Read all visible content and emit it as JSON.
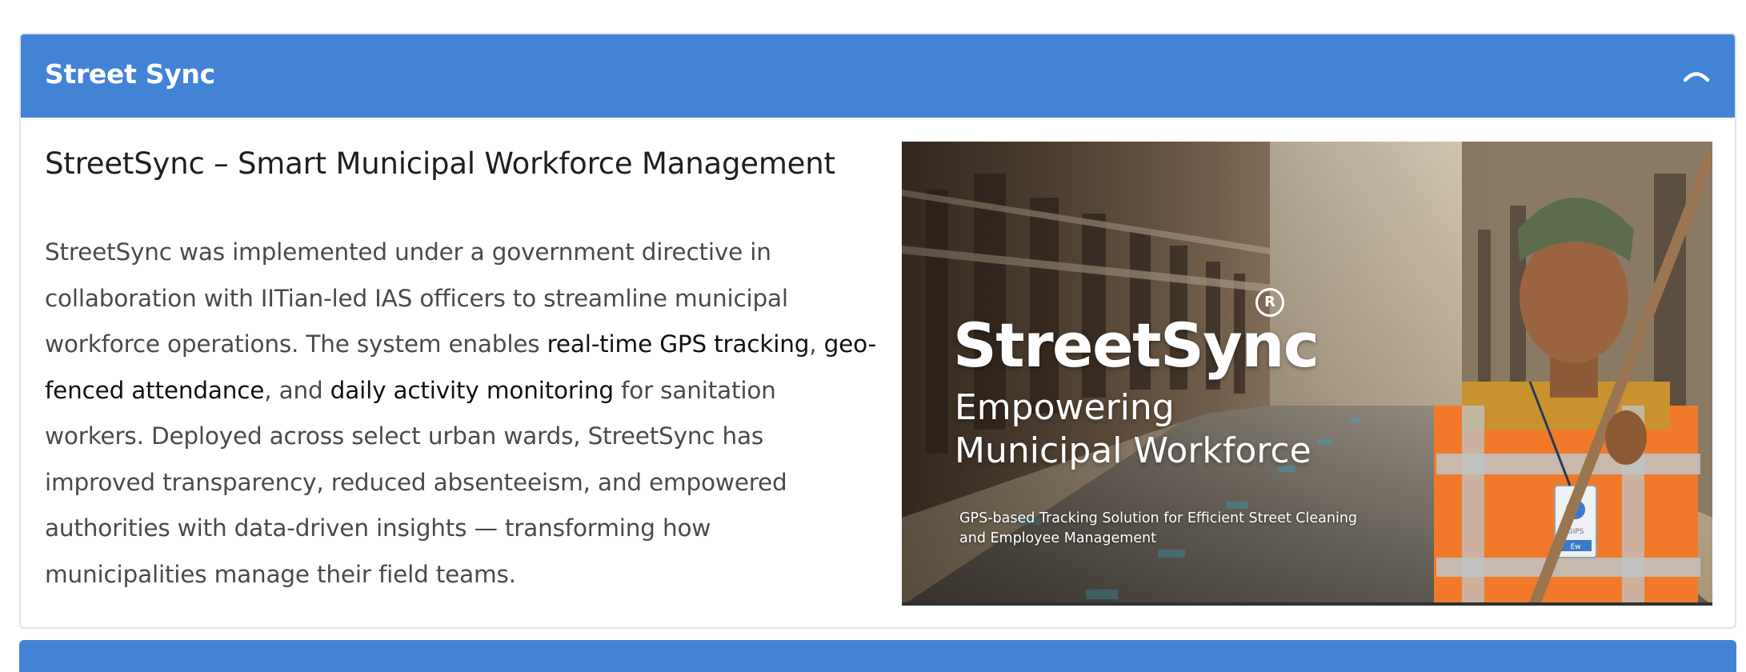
{
  "section": {
    "title": "Street Sync",
    "toggle_icon": "chevron-up-icon"
  },
  "content": {
    "heading": "StreetSync – Smart Municipal Workforce Management",
    "paragraph": {
      "p1": "StreetSync was implemented under a government directive in collaboration with IITian-led IAS officers to streamline municipal workforce operations. The system enables ",
      "h1": "real-time GPS tracking",
      "p2": ", ",
      "h2": "geo-fenced attendance",
      "p3": ", and ",
      "h3": "daily activity monitoring",
      "p4": " for sanitation workers. Deployed across select urban wards, StreetSync has improved transparency, reduced absenteeism, and empowered authorities with data-driven insights — transforming how municipalities manage their field teams."
    }
  },
  "banner": {
    "brand": "StreetSync",
    "registered_mark": "R",
    "tagline_line1": "Empowering",
    "tagline_line2": "Municipal Workforce",
    "subtext_line1": "GPS-based Tracking Solution for Efficient Street Cleaning",
    "subtext_line2": "and Employee Management",
    "id_card_text_top": "GIPS",
    "id_card_text_bottom": "Ew"
  },
  "colors": {
    "header_bg": "#4383d6",
    "header_text": "#ffffff",
    "body_text": "#4a4a4a",
    "highlight_text": "#111111",
    "vest_orange": "#f07a2a"
  }
}
